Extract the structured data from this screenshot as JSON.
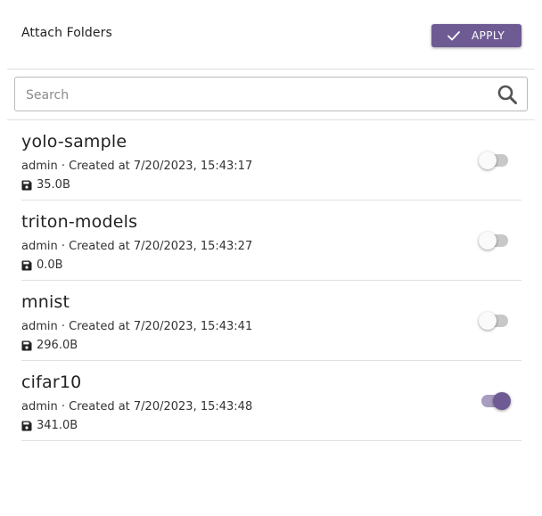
{
  "header": {
    "title": "Attach Folders",
    "apply_label": "APPLY"
  },
  "search": {
    "placeholder": "Search",
    "value": ""
  },
  "colors": {
    "accent": "#6e5b94",
    "divider": "#e0e0e0"
  },
  "folders": [
    {
      "name": "yolo-sample",
      "meta": "admin · Created at 7/20/2023, 15:43:17",
      "size": "35.0B",
      "attached": false
    },
    {
      "name": "triton-models",
      "meta": "admin · Created at 7/20/2023, 15:43:27",
      "size": "0.0B",
      "attached": false
    },
    {
      "name": "mnist",
      "meta": "admin · Created at 7/20/2023, 15:43:41",
      "size": "296.0B",
      "attached": false
    },
    {
      "name": "cifar10",
      "meta": "admin · Created at 7/20/2023, 15:43:48",
      "size": "341.0B",
      "attached": true
    }
  ]
}
